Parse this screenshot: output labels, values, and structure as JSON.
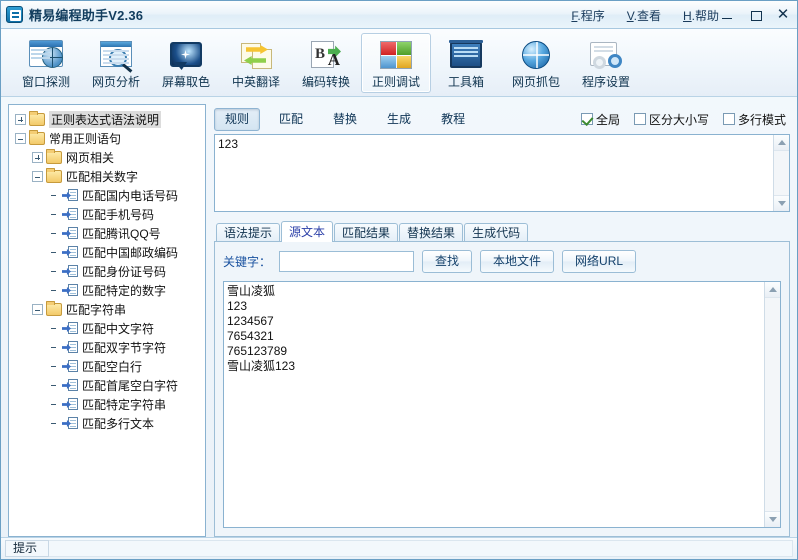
{
  "window": {
    "title": "精易编程助手V2.36",
    "logo_icon": "app-logo-icon",
    "menus": [
      {
        "acc": "F",
        "label": ".程序"
      },
      {
        "acc": "V",
        "label": ".查看"
      },
      {
        "acc": "H",
        "label": ".帮助"
      }
    ],
    "buttons": {
      "minimize": "minimize-icon",
      "maximize": "maximize-icon",
      "close": "✕"
    }
  },
  "toolbar": {
    "items": [
      {
        "label": "窗口探测",
        "icon": "window-detect-icon",
        "active": false
      },
      {
        "label": "网页分析",
        "icon": "webpage-analyze-icon",
        "active": false
      },
      {
        "label": "屏幕取色",
        "icon": "screen-color-picker-icon",
        "active": false
      },
      {
        "label": "中英翻译",
        "icon": "translate-icon",
        "active": false
      },
      {
        "label": "编码转换",
        "icon": "encoding-convert-icon",
        "active": false
      },
      {
        "label": "正则调试",
        "icon": "regex-debug-icon",
        "active": true
      },
      {
        "label": "工具箱",
        "icon": "toolbox-icon",
        "active": false
      },
      {
        "label": "网页抓包",
        "icon": "web-capture-icon",
        "active": false
      },
      {
        "label": "程序设置",
        "icon": "settings-icon",
        "active": false
      }
    ]
  },
  "tree": {
    "nodes": [
      {
        "label": "正则表达式语法说明",
        "depth": 0,
        "type": "folder",
        "twisty": "plus",
        "selected": true
      },
      {
        "label": "常用正则语句",
        "depth": 0,
        "type": "folder",
        "twisty": "minus",
        "selected": false
      },
      {
        "label": "网页相关",
        "depth": 1,
        "type": "folder",
        "twisty": "plus",
        "selected": false
      },
      {
        "label": "匹配相关数字",
        "depth": 1,
        "type": "folder",
        "twisty": "minus",
        "selected": false
      },
      {
        "label": "匹配国内电话号码",
        "depth": 2,
        "type": "leaf",
        "twisty": "none",
        "selected": false
      },
      {
        "label": "匹配手机号码",
        "depth": 2,
        "type": "leaf",
        "twisty": "none",
        "selected": false
      },
      {
        "label": "匹配腾讯QQ号",
        "depth": 2,
        "type": "leaf",
        "twisty": "none",
        "selected": false
      },
      {
        "label": "匹配中国邮政编码",
        "depth": 2,
        "type": "leaf",
        "twisty": "none",
        "selected": false
      },
      {
        "label": "匹配身份证号码",
        "depth": 2,
        "type": "leaf",
        "twisty": "none",
        "selected": false
      },
      {
        "label": "匹配特定的数字",
        "depth": 2,
        "type": "leaf",
        "twisty": "none",
        "selected": false
      },
      {
        "label": "匹配字符串",
        "depth": 1,
        "type": "folder",
        "twisty": "minus",
        "selected": false
      },
      {
        "label": "匹配中文字符",
        "depth": 2,
        "type": "leaf",
        "twisty": "none",
        "selected": false
      },
      {
        "label": "匹配双字节字符",
        "depth": 2,
        "type": "leaf",
        "twisty": "none",
        "selected": false
      },
      {
        "label": "匹配空白行",
        "depth": 2,
        "type": "leaf",
        "twisty": "none",
        "selected": false
      },
      {
        "label": "匹配首尾空白字符",
        "depth": 2,
        "type": "leaf",
        "twisty": "none",
        "selected": false
      },
      {
        "label": "匹配特定字符串",
        "depth": 2,
        "type": "leaf",
        "twisty": "none",
        "selected": false
      },
      {
        "label": "匹配多行文本",
        "depth": 2,
        "type": "leaf",
        "twisty": "none",
        "selected": false
      }
    ]
  },
  "rule_bar": {
    "buttons": [
      {
        "label": "规则",
        "pressed": true
      },
      {
        "label": "匹配",
        "pressed": false
      },
      {
        "label": "替换",
        "pressed": false
      },
      {
        "label": "生成",
        "pressed": false
      },
      {
        "label": "教程",
        "pressed": false
      }
    ],
    "checkboxes": [
      {
        "label": "全局",
        "checked": true
      },
      {
        "label": "区分大小写",
        "checked": false
      },
      {
        "label": "多行模式",
        "checked": false
      }
    ]
  },
  "rule_editor": {
    "value": "123"
  },
  "tabs": [
    {
      "label": "语法提示",
      "active": false
    },
    {
      "label": "源文本",
      "active": true
    },
    {
      "label": "匹配结果",
      "active": false
    },
    {
      "label": "替换结果",
      "active": false
    },
    {
      "label": "生成代码",
      "active": false
    }
  ],
  "source_panel": {
    "keyword_label": "关键字：",
    "keyword_value": "",
    "keyword_placeholder": "",
    "find_button": "查找",
    "local_file_button": "本地文件",
    "network_url_button": "网络URL",
    "text": "雪山凌狐\n123\n1234567\n7654321\n765123789\n雪山凌狐123"
  },
  "statusbar": {
    "hint": "提示"
  },
  "colors": {
    "accent": "#1a52a0",
    "border": "#8ab2d0",
    "title_text": "#123d5e",
    "panel_bg": "#eff5fa",
    "checked_mark": "#3c8a30"
  }
}
